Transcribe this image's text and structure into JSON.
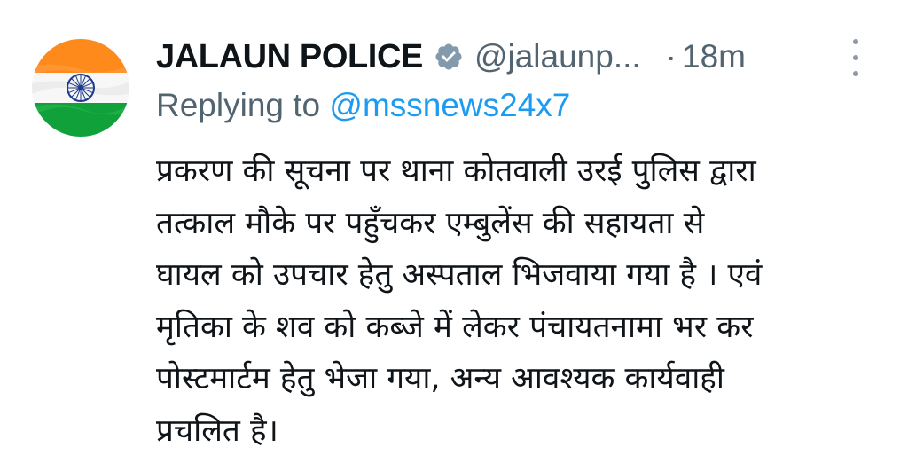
{
  "tweet": {
    "author": {
      "display_name": "JALAUN POLICE",
      "handle": "@jalaunp...",
      "verified_icon": "verified-badge-icon",
      "avatar_icon": "indian-flag-avatar"
    },
    "separator": "·",
    "time": "18m",
    "more_icon": "more-vertical-icon",
    "reply": {
      "prefix": "Replying to",
      "handle": "@mssnews24x7"
    },
    "text_lines": [
      "प्रकरण की सूचना पर थाना कोतवाली उरई पुलिस द्वारा",
      "तत्काल मौके पर पहुँचकर एम्बुलेंस की सहायता से",
      "घायल को उपचार हेतु अस्पताल भिजवाया गया है । एवं",
      "मृतिका के शव को कब्जे में लेकर पंचायतनामा भर कर",
      "पोस्टमार्टम हेतु भेजा गया, अन्य आवश्यक कार्यवाही",
      "प्रचलित है।"
    ]
  },
  "colors": {
    "text_primary": "#0f1419",
    "text_secondary": "#536471",
    "link": "#1d9bf0",
    "verified_badge": "#829aab",
    "flag_saffron": "#ff8a1c",
    "flag_white": "#ffffff",
    "flag_green": "#11a13a",
    "chakra_navy": "#1a3a8f"
  }
}
